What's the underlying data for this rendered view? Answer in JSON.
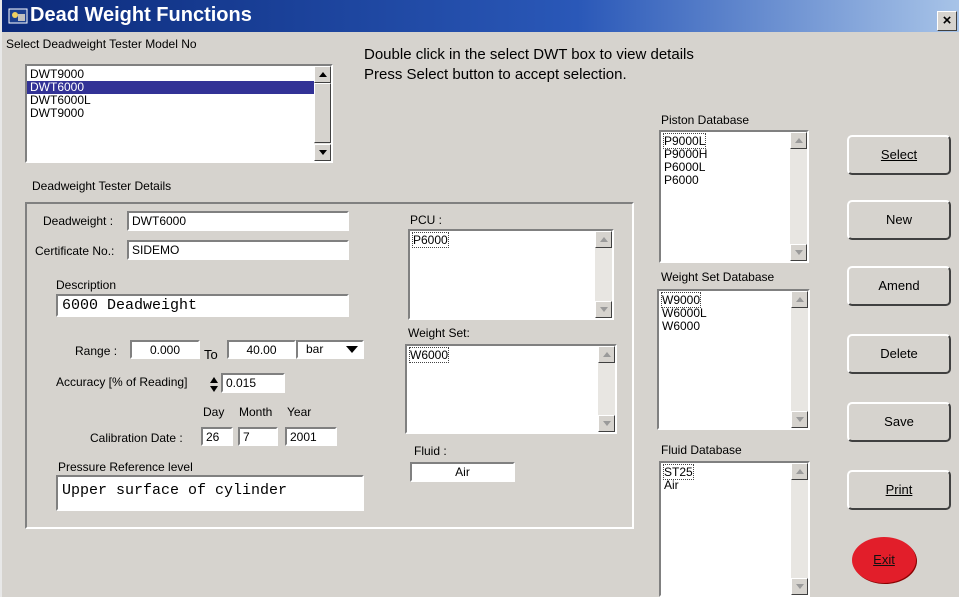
{
  "window": {
    "title": "Dead Weight Functions",
    "close_label": "×"
  },
  "model_select": {
    "label": "Select Deadweight Tester Model No",
    "items": [
      {
        "label": "DWT9000",
        "selected": false
      },
      {
        "label": "DWT6000",
        "selected": true
      },
      {
        "label": "DWT6000L",
        "selected": false
      },
      {
        "label": "DWT9000",
        "selected": false
      }
    ]
  },
  "instructions": {
    "line1": "Double click in the select DWT box to view details",
    "line2": "Press Select button to accept selection."
  },
  "details": {
    "group_label": "Deadweight Tester Details",
    "deadweight_label": "Deadweight :",
    "deadweight_value": "DWT6000",
    "certificate_label": "Certificate No.:",
    "certificate_value": "SIDEMO",
    "description_label": "Description",
    "description_value": "6000 Deadweight",
    "range_label": "Range :",
    "range_from": "0.000",
    "range_to_label": "To",
    "range_to": "40.00",
    "unit": "bar",
    "accuracy_label": "Accuracy [% of Reading]",
    "accuracy_value": "0.015",
    "day_label": "Day",
    "month_label": "Month",
    "year_label": "Year",
    "calibration_label": "Calibration Date :",
    "cal_day": "26",
    "cal_month": "7",
    "cal_year": "2001",
    "pressure_ref_label": "Pressure Reference level",
    "pressure_ref_value": "Upper surface of cylinder",
    "pcu_label": "PCU :",
    "pcu_items": [
      "P6000"
    ],
    "weight_set_label": "Weight Set:",
    "weight_set_items": [
      "W6000"
    ],
    "fluid_label": "Fluid :",
    "fluid_value": "Air"
  },
  "piston_db": {
    "label": "Piston Database",
    "items": [
      "P9000L",
      "P9000H",
      "P6000L",
      "P6000"
    ]
  },
  "weight_db": {
    "label": "Weight Set Database",
    "items": [
      "W9000",
      "W6000L",
      "W6000"
    ]
  },
  "fluid_db": {
    "label": "Fluid Database",
    "items": [
      "ST25",
      "Air"
    ]
  },
  "buttons": {
    "select": "Select",
    "new": "New",
    "amend": "Amend",
    "delete": "Delete",
    "save": "Save",
    "print": "Print",
    "exit": "Exit"
  },
  "colors": {
    "title_bar": "#0b2a7a",
    "selection": "#323296",
    "exit_button": "#e21e2a",
    "face": "#d6d3ce"
  },
  "icons": [
    "app-icon",
    "close-icon",
    "scroll-up-icon",
    "scroll-down-icon",
    "dropdown-arrow-icon",
    "spinner-icon"
  ]
}
